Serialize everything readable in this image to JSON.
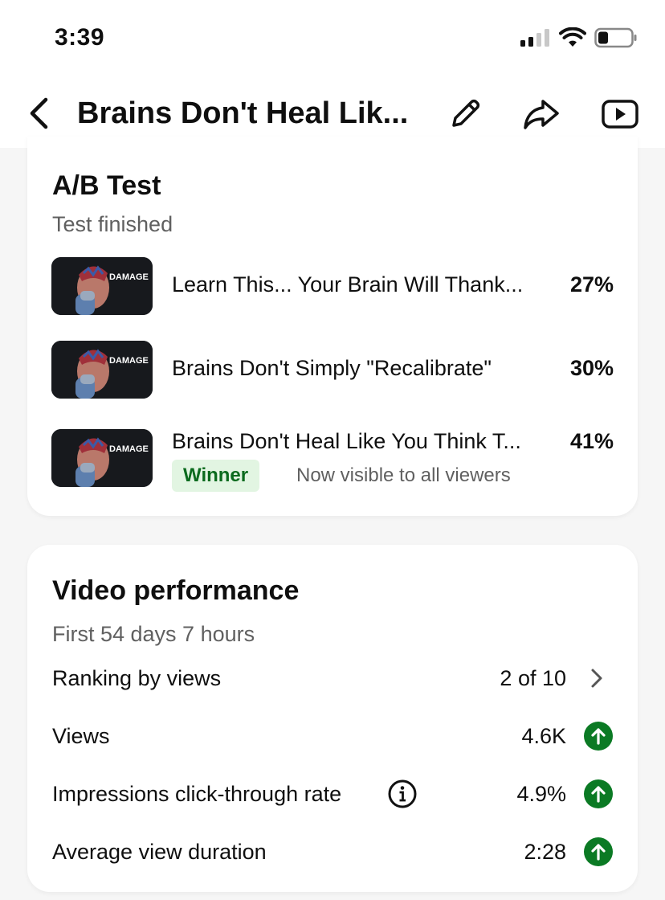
{
  "status_bar": {
    "time": "3:39"
  },
  "header": {
    "title": "Brains Don't Heal Lik..."
  },
  "ab_test": {
    "title": "A/B Test",
    "status": "Test finished",
    "thumb_caption": "DAMAGE",
    "variants": [
      {
        "title": "Learn This... Your Brain Will Thank...",
        "percent": "27%"
      },
      {
        "title": "Brains Don't Simply \"Recalibrate\"",
        "percent": "30%"
      },
      {
        "title": "Brains Don't Heal Like You Think T...",
        "percent": "41%",
        "badge": "Winner",
        "note": "Now visible to all viewers"
      }
    ]
  },
  "performance": {
    "title": "Video performance",
    "period": "First 54 days 7 hours",
    "metrics": [
      {
        "label": "Ranking by views",
        "value": "2 of 10",
        "indicator": "chevron-right-icon"
      },
      {
        "label": "Views",
        "value": "4.6K",
        "indicator": "arrow-up-icon"
      },
      {
        "label": "Impressions click-through rate",
        "value": "4.9%",
        "indicator": "arrow-up-icon"
      },
      {
        "label": "Average view duration",
        "value": "2:28",
        "indicator": "arrow-up-icon"
      }
    ]
  },
  "colors": {
    "positive": "#0b7a24",
    "winner_bg": "#e2f5e2",
    "winner_text": "#0b6b1e",
    "secondary_text": "#606060"
  }
}
